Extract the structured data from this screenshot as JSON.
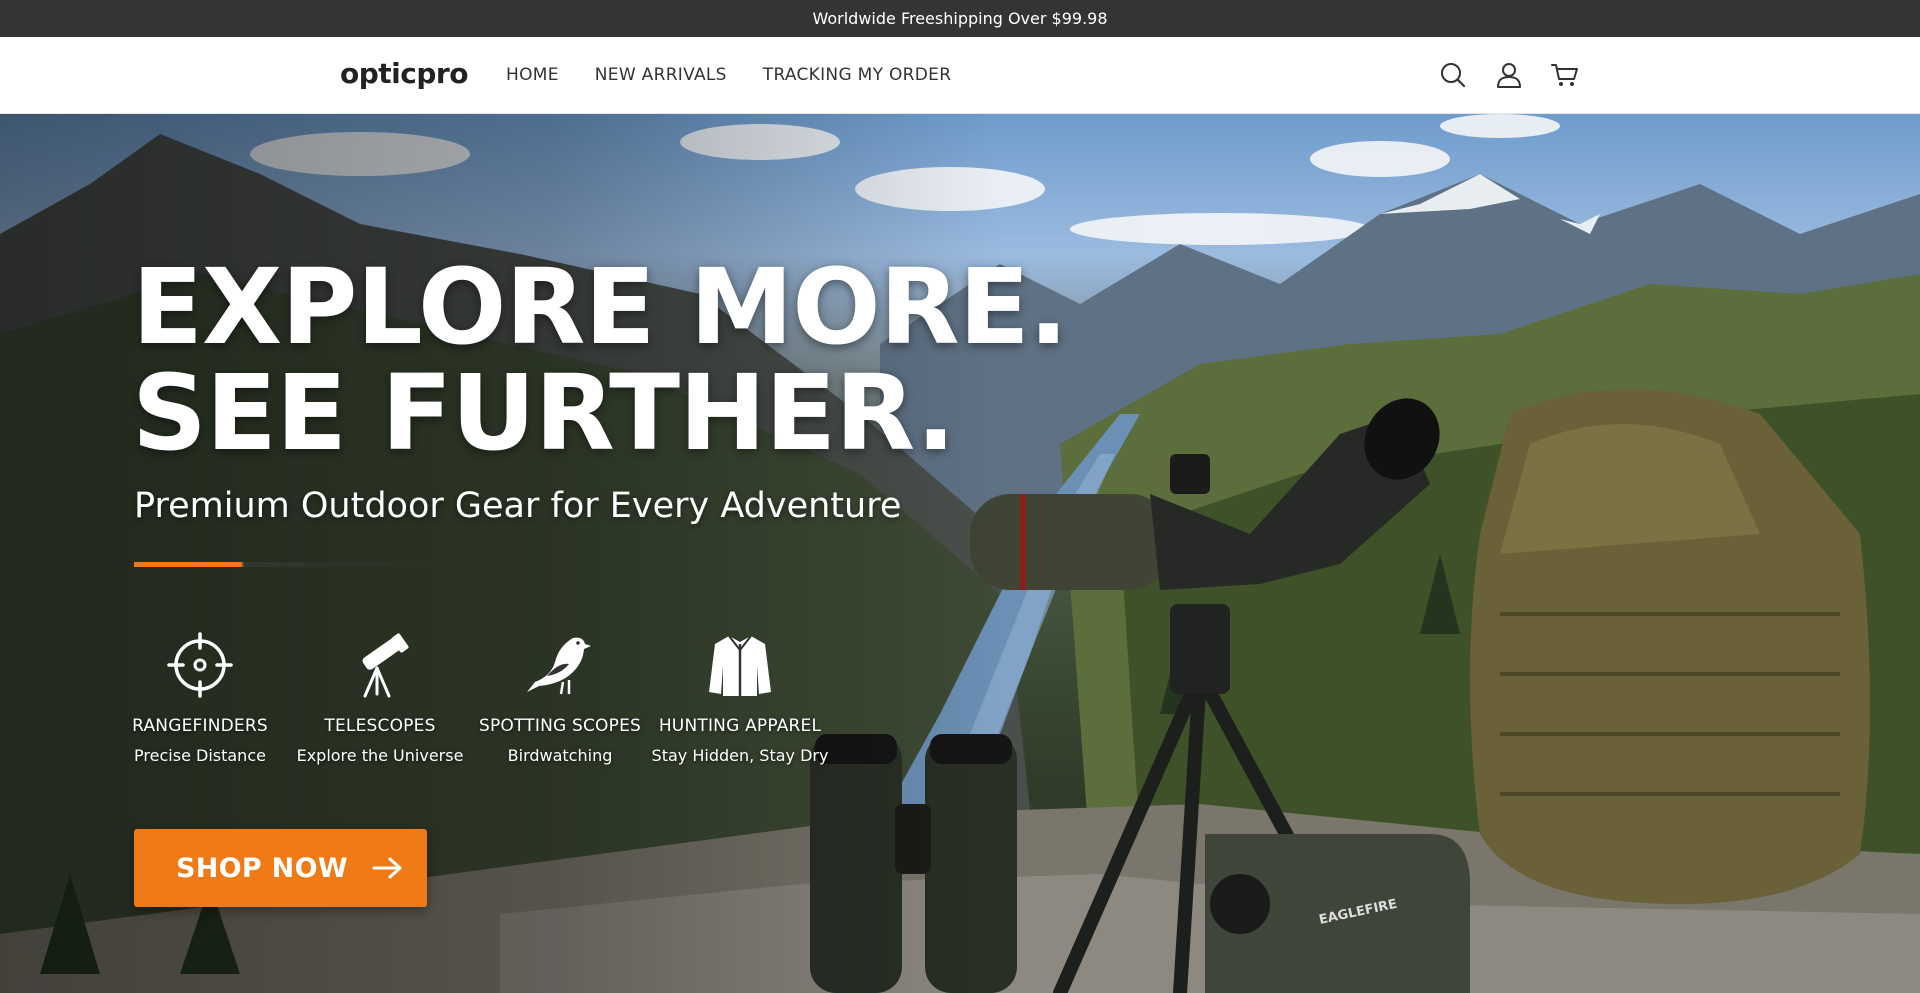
{
  "announcement": {
    "text": "Worldwide Freeshipping Over $99.98"
  },
  "header": {
    "logo": "opticpro",
    "nav": [
      {
        "label": "HOME"
      },
      {
        "label": "NEW ARRIVALS"
      },
      {
        "label": "TRACKING MY ORDER"
      }
    ],
    "icons": [
      "search-icon",
      "account-icon",
      "cart-icon"
    ]
  },
  "hero": {
    "headline_line1": "EXPLORE MORE.",
    "headline_line2": "SEE FURTHER.",
    "subheadline": "Premium Outdoor Gear for Every Adventure",
    "features": [
      {
        "title": "RANGEFINDERS",
        "subtitle": "Precise Distance",
        "icon": "crosshair-icon"
      },
      {
        "title": "TELESCOPES",
        "subtitle": "Explore the Universe",
        "icon": "telescope-icon"
      },
      {
        "title": "SPOTTING SCOPES",
        "subtitle": "Birdwatching",
        "icon": "bird-icon"
      },
      {
        "title": "HUNTING APPAREL",
        "subtitle": "Stay Hidden, Stay Dry",
        "icon": "jacket-icon"
      }
    ],
    "cta_label": "SHOP NOW",
    "rangefinder_brand": "EAGLEFIRE"
  },
  "colors": {
    "accent": "#f07a15",
    "announcement_bg": "#333535"
  }
}
